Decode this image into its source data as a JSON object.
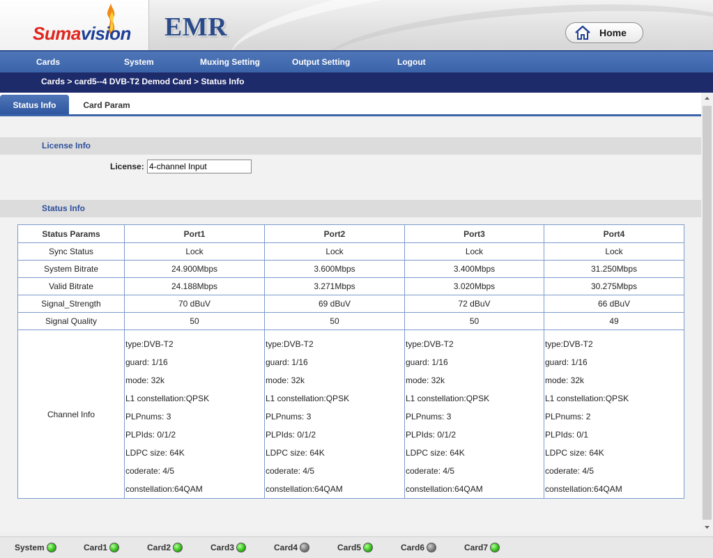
{
  "header": {
    "logo": {
      "part1": "Suma",
      "part2": "vision"
    },
    "app_title": "EMR",
    "home_button": "Home"
  },
  "nav": {
    "items": [
      "Cards",
      "System",
      "Muxing Setting",
      "Output Setting",
      "Logout"
    ]
  },
  "breadcrumb": "Cards > card5--4 DVB-T2 Demod Card > Status Info",
  "tabs": [
    {
      "label": "Status Info",
      "active": true
    },
    {
      "label": "Card Param",
      "active": false
    }
  ],
  "license_section": {
    "title": "License Info",
    "label": "License:",
    "value": "4-channel Input"
  },
  "status_section": {
    "title": "Status Info",
    "headers": [
      "Status Params",
      "Port1",
      "Port2",
      "Port3",
      "Port4"
    ],
    "rows": [
      {
        "param": "Sync Status",
        "values": [
          "Lock",
          "Lock",
          "Lock",
          "Lock"
        ]
      },
      {
        "param": "System Bitrate",
        "values": [
          "24.900Mbps",
          "3.600Mbps",
          "3.400Mbps",
          "31.250Mbps"
        ]
      },
      {
        "param": "Valid Bitrate",
        "values": [
          "24.188Mbps",
          "3.271Mbps",
          "3.020Mbps",
          "30.275Mbps"
        ]
      },
      {
        "param": "Signal_Strength",
        "values": [
          "70 dBuV",
          "69 dBuV",
          "72 dBuV",
          "66 dBuV"
        ]
      },
      {
        "param": "Signal Quality",
        "values": [
          "50",
          "50",
          "50",
          "49"
        ]
      }
    ],
    "channel_info": {
      "param": "Channel Info",
      "ports": [
        [
          "type:DVB-T2",
          "guard: 1/16",
          "mode: 32k",
          "L1 constellation:QPSK",
          "PLPnums: 3",
          "PLPIds: 0/1/2",
          "LDPC size: 64K",
          "coderate: 4/5",
          "constellation:64QAM"
        ],
        [
          "type:DVB-T2",
          "guard: 1/16",
          "mode: 32k",
          "L1 constellation:QPSK",
          "PLPnums: 3",
          "PLPIds: 0/1/2",
          "LDPC size: 64K",
          "coderate: 4/5",
          "constellation:64QAM"
        ],
        [
          "type:DVB-T2",
          "guard: 1/16",
          "mode: 32k",
          "L1 constellation:QPSK",
          "PLPnums: 3",
          "PLPIds: 0/1/2",
          "LDPC size: 64K",
          "coderate: 4/5",
          "constellation:64QAM"
        ],
        [
          "type:DVB-T2",
          "guard: 1/16",
          "mode: 32k",
          "L1 constellation:QPSK",
          "PLPnums: 2",
          "PLPIds: 0/1",
          "LDPC size: 64K",
          "coderate: 4/5",
          "constellation:64QAM"
        ]
      ]
    }
  },
  "statusbar": [
    {
      "label": "System",
      "status": "on"
    },
    {
      "label": "Card1",
      "status": "on"
    },
    {
      "label": "Card2",
      "status": "on"
    },
    {
      "label": "Card3",
      "status": "on"
    },
    {
      "label": "Card4",
      "status": "off"
    },
    {
      "label": "Card5",
      "status": "on"
    },
    {
      "label": "Card6",
      "status": "off"
    },
    {
      "label": "Card7",
      "status": "on"
    }
  ],
  "colors": {
    "nav_blue": "#3b63a9",
    "breadcrumb_navy": "#1e2b6b",
    "section_title": "#2d4f9a",
    "status_on": "#36c21a",
    "status_off": "#7d7d7d"
  }
}
